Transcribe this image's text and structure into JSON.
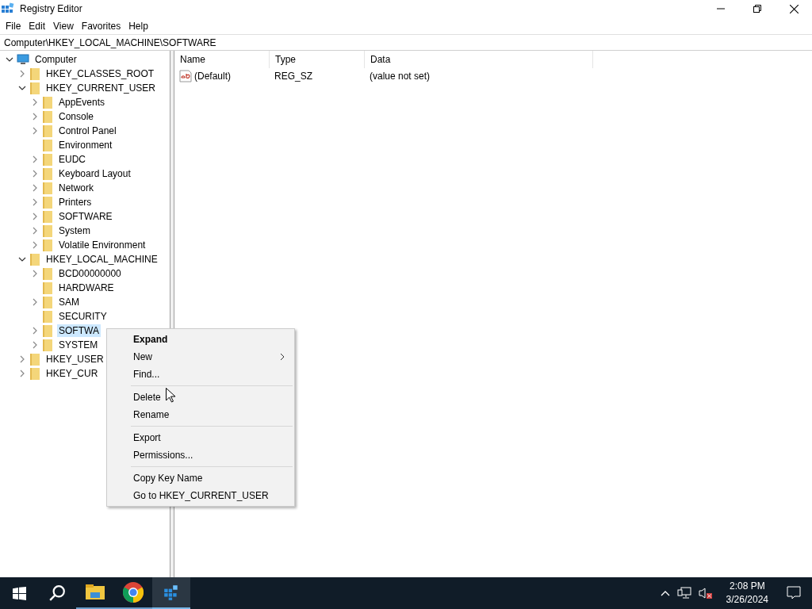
{
  "window": {
    "title": "Registry Editor"
  },
  "menu_bar": [
    "File",
    "Edit",
    "View",
    "Favorites",
    "Help"
  ],
  "address": "Computer\\HKEY_LOCAL_MACHINE\\SOFTWARE",
  "tree": [
    {
      "label": "Computer",
      "kind": "computer",
      "expandable": true,
      "expanded": true,
      "selected": false,
      "children": [
        {
          "label": "HKEY_CLASSES_ROOT",
          "expandable": true,
          "expanded": false,
          "selected": false
        },
        {
          "label": "HKEY_CURRENT_USER",
          "expandable": true,
          "expanded": true,
          "selected": false,
          "children": [
            {
              "label": "AppEvents",
              "expandable": true,
              "expanded": false,
              "selected": false
            },
            {
              "label": "Console",
              "expandable": true,
              "expanded": false,
              "selected": false
            },
            {
              "label": "Control Panel",
              "expandable": true,
              "expanded": false,
              "selected": false
            },
            {
              "label": "Environment",
              "expandable": false,
              "expanded": false,
              "selected": false
            },
            {
              "label": "EUDC",
              "expandable": true,
              "expanded": false,
              "selected": false
            },
            {
              "label": "Keyboard Layout",
              "expandable": true,
              "expanded": false,
              "selected": false
            },
            {
              "label": "Network",
              "expandable": true,
              "expanded": false,
              "selected": false
            },
            {
              "label": "Printers",
              "expandable": true,
              "expanded": false,
              "selected": false
            },
            {
              "label": "SOFTWARE",
              "expandable": true,
              "expanded": false,
              "selected": false
            },
            {
              "label": "System",
              "expandable": true,
              "expanded": false,
              "selected": false
            },
            {
              "label": "Volatile Environment",
              "expandable": true,
              "expanded": false,
              "selected": false
            }
          ]
        },
        {
          "label": "HKEY_LOCAL_MACHINE",
          "expandable": true,
          "expanded": true,
          "selected": false,
          "children": [
            {
              "label": "BCD00000000",
              "expandable": true,
              "expanded": false,
              "selected": false
            },
            {
              "label": "HARDWARE",
              "expandable": false,
              "expanded": false,
              "selected": false
            },
            {
              "label": "SAM",
              "expandable": true,
              "expanded": false,
              "selected": false
            },
            {
              "label": "SECURITY",
              "expandable": false,
              "expanded": false,
              "selected": false
            },
            {
              "label": "SOFTWA",
              "expandable": true,
              "expanded": false,
              "selected": true
            },
            {
              "label": "SYSTEM",
              "expandable": true,
              "expanded": false,
              "selected": false
            }
          ]
        },
        {
          "label": "HKEY_USER",
          "expandable": true,
          "expanded": false,
          "selected": false
        },
        {
          "label": "HKEY_CUR",
          "expandable": true,
          "expanded": false,
          "selected": false
        }
      ]
    }
  ],
  "table": {
    "columns": [
      "Name",
      "Type",
      "Data"
    ],
    "rows": [
      {
        "name": "(Default)",
        "type": "REG_SZ",
        "data": "(value not set)"
      }
    ]
  },
  "context_menu": [
    {
      "label": "Expand",
      "kind": "item",
      "bold": true,
      "submenu": false
    },
    {
      "label": "New",
      "kind": "item",
      "bold": false,
      "submenu": true
    },
    {
      "label": "Find...",
      "kind": "item",
      "bold": false,
      "submenu": false
    },
    {
      "kind": "separator"
    },
    {
      "label": "Delete",
      "kind": "item",
      "bold": false,
      "submenu": false
    },
    {
      "label": "Rename",
      "kind": "item",
      "bold": false,
      "submenu": false
    },
    {
      "kind": "separator"
    },
    {
      "label": "Export",
      "kind": "item",
      "bold": false,
      "submenu": false
    },
    {
      "label": "Permissions...",
      "kind": "item",
      "bold": false,
      "submenu": false
    },
    {
      "kind": "separator"
    },
    {
      "label": "Copy Key Name",
      "kind": "item",
      "bold": false,
      "submenu": false
    },
    {
      "label": "Go to HKEY_CURRENT_USER",
      "kind": "item",
      "bold": false,
      "submenu": false
    }
  ],
  "taskbar": {
    "apps": [
      {
        "kind": "explorer",
        "selected": false
      },
      {
        "kind": "chrome",
        "selected": false
      },
      {
        "kind": "regedit",
        "selected": true
      }
    ],
    "time": "2:08 PM",
    "date": "3/26/2024"
  }
}
